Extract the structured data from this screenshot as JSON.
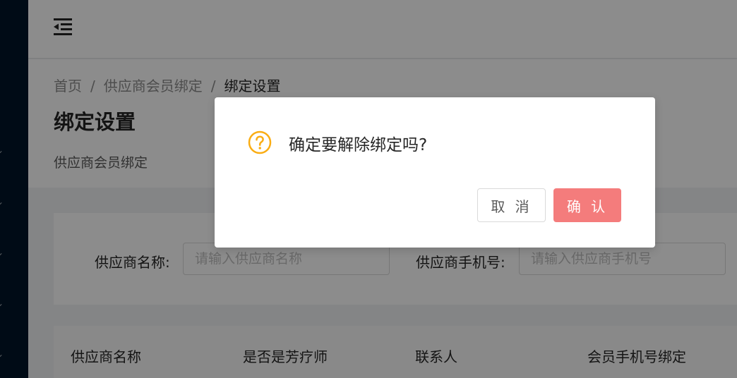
{
  "header": {
    "menu_toggle_icon": "menu-fold-icon"
  },
  "breadcrumb": {
    "items": [
      "首页",
      "供应商会员绑定",
      "绑定设置"
    ],
    "separator": "/"
  },
  "page": {
    "title": "绑定设置",
    "subtitle": "供应商会员绑定"
  },
  "search": {
    "supplier_name_label": "供应商名称:",
    "supplier_name_placeholder": "请输入供应商名称",
    "supplier_phone_label": "供应商手机号:",
    "supplier_phone_placeholder": "请输入供应商手机号"
  },
  "table": {
    "columns": [
      "供应商名称",
      "是否是芳疗师",
      "联系人",
      "会员手机号绑定"
    ]
  },
  "modal": {
    "icon": "question-circle-icon",
    "title": "确定要解除绑定吗?",
    "cancel_label": "取 消",
    "ok_label": "确 认"
  },
  "colors": {
    "warning": "#faad14",
    "primary_button": "#f47c7c",
    "sidebar": "#001529"
  }
}
